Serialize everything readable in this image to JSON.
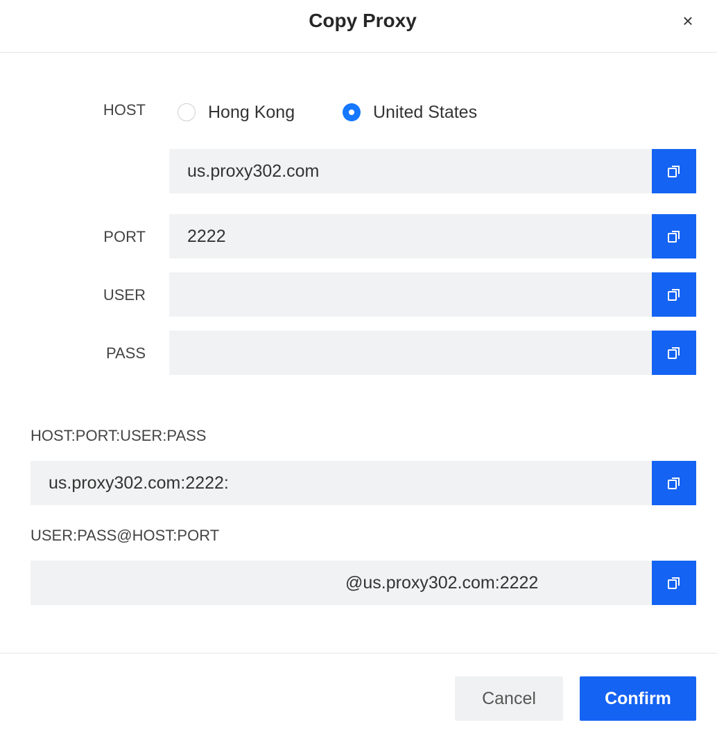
{
  "dialog": {
    "title": "Copy Proxy",
    "close_symbol": "×"
  },
  "host": {
    "label": "HOST",
    "options": [
      {
        "label": "Hong Kong",
        "selected": false
      },
      {
        "label": "United States",
        "selected": true
      }
    ],
    "value": "us.proxy302.com"
  },
  "port": {
    "label": "PORT",
    "value": "2222"
  },
  "user": {
    "label": "USER",
    "value": ""
  },
  "pass": {
    "label": "PASS",
    "value": ""
  },
  "format1": {
    "label": "HOST:PORT:USER:PASS",
    "value": "us.proxy302.com:2222:"
  },
  "format2": {
    "label": "USER:PASS@HOST:PORT",
    "value": "@us.proxy302.com:2222"
  },
  "footer": {
    "cancel_label": "Cancel",
    "confirm_label": "Confirm"
  },
  "icons": {
    "copy": "copy-icon",
    "close": "close-icon"
  },
  "colors": {
    "accent": "#1563f2",
    "field_bg": "#f1f2f3",
    "radio_on": "#1677ff"
  }
}
